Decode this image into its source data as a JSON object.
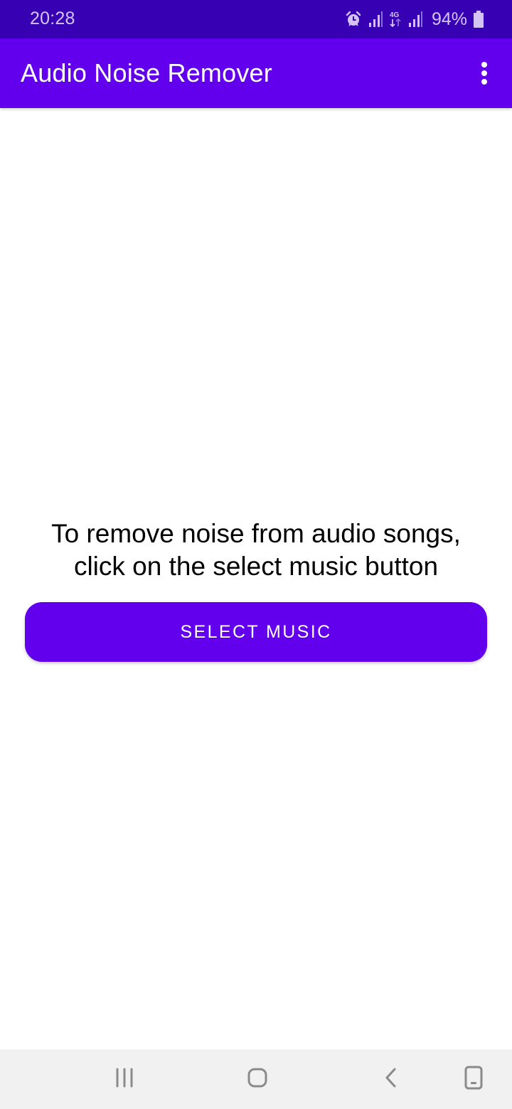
{
  "status_bar": {
    "time": "20:28",
    "battery_percent": "94%",
    "icons": [
      "alarm-icon",
      "signal-icon",
      "4g-data-icon",
      "signal-icon",
      "battery-icon"
    ],
    "network_label": "4G"
  },
  "app_bar": {
    "title": "Audio Noise Remover",
    "overflow_icon": "more-vert-icon"
  },
  "main": {
    "instruction": "To remove noise from audio songs,\nclick on the select music button",
    "select_button_label": "SELECT MUSIC"
  },
  "nav_bar": {
    "buttons": [
      "recent-apps",
      "home",
      "back",
      "keyboard-toggle"
    ]
  },
  "colors": {
    "status_bar": "#3700b3",
    "primary": "#6200ee",
    "nav_bar": "#f1f1f1"
  }
}
